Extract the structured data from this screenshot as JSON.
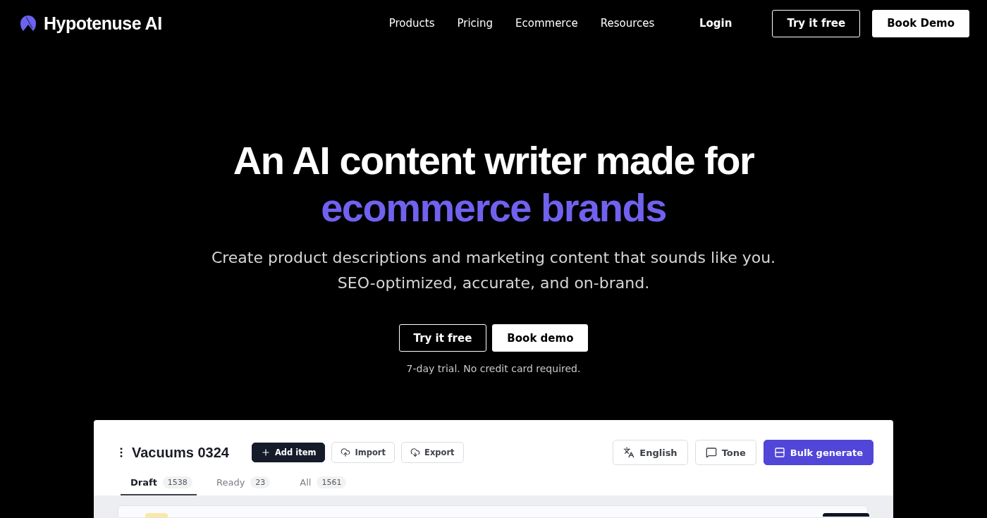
{
  "brand": {
    "name": "Hypotenuse AI"
  },
  "nav": {
    "links": [
      "Products",
      "Pricing",
      "Ecommerce",
      "Resources"
    ],
    "login": "Login",
    "try_button": "Try it free",
    "demo_button": "Book Demo"
  },
  "hero": {
    "title": "An AI content writer made for",
    "title_highlight": "ecommerce brands",
    "subtitle_lines": [
      "Create product descriptions and marketing content that sounds like you.",
      "SEO-optimized, accurate, and on-brand."
    ],
    "try_button": "Try it free",
    "demo_button": "Book demo",
    "note": "7-day trial. No credit card required."
  },
  "app": {
    "title": "Vacuums 0324",
    "actions": [
      {
        "kind": "add",
        "label": "Add item"
      },
      {
        "kind": "import",
        "label": "Import"
      },
      {
        "kind": "export",
        "label": "Export"
      }
    ],
    "tools": [
      {
        "kind": "language",
        "label": "English"
      },
      {
        "kind": "tone",
        "label": "Tone"
      },
      {
        "kind": "bulk",
        "label": "Bulk generate"
      }
    ],
    "tabs": [
      {
        "label": "Draft",
        "count": "1538",
        "selected": true
      },
      {
        "label": "Ready",
        "count": "23",
        "selected": false
      },
      {
        "label": "All",
        "count": "1561",
        "selected": false
      }
    ]
  }
}
